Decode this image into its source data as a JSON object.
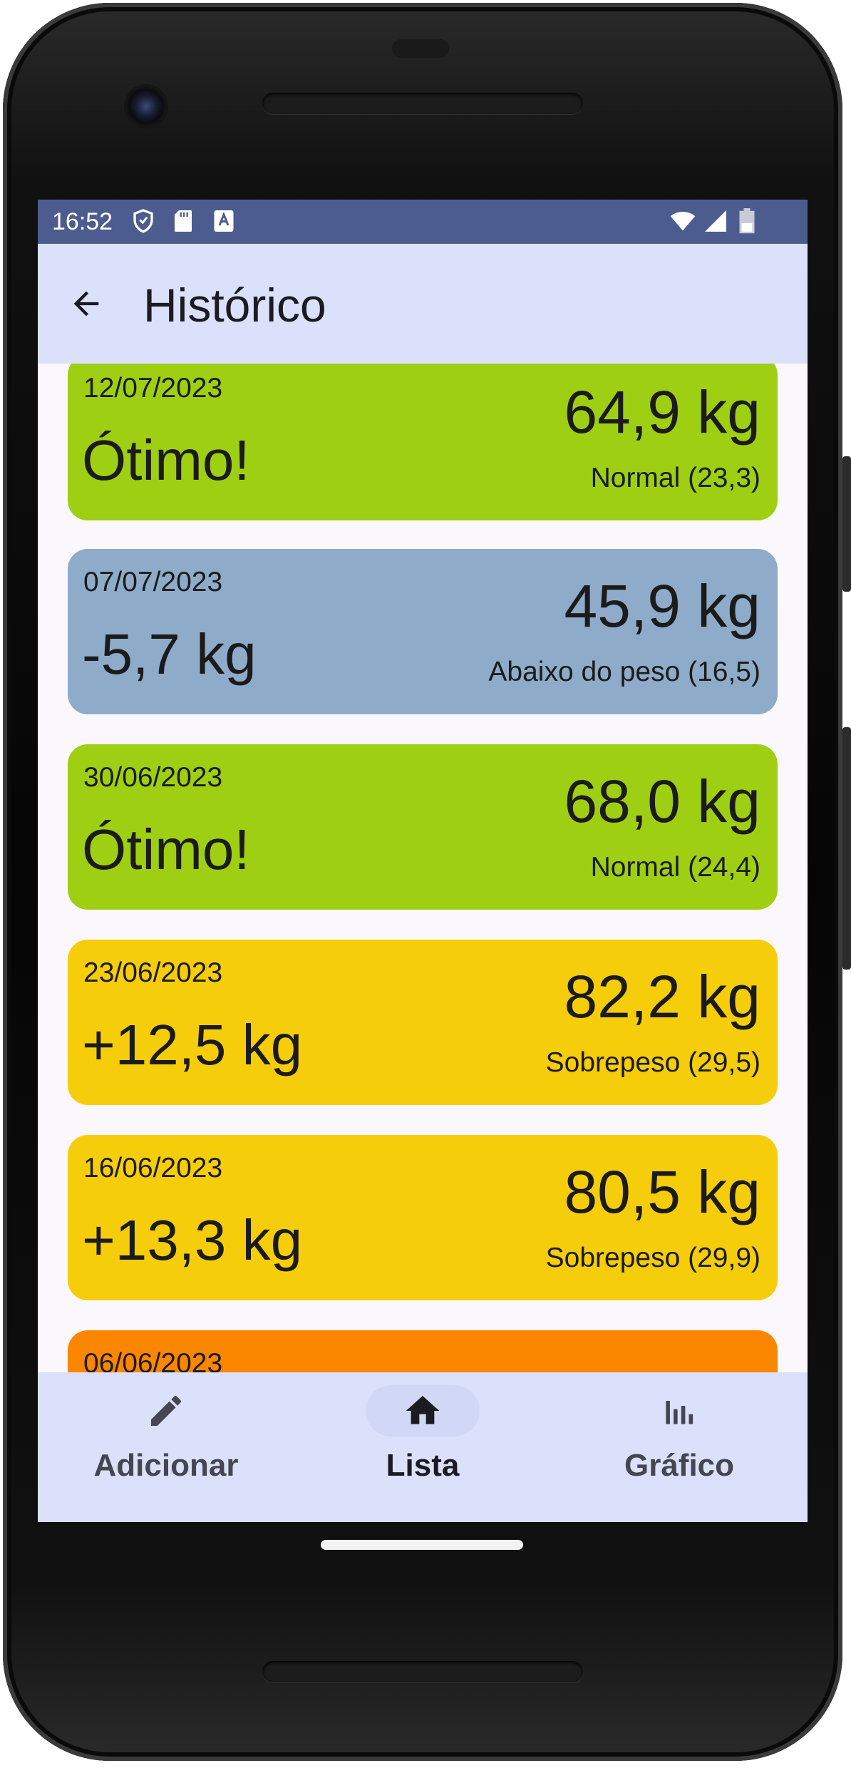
{
  "status_bar": {
    "time": "16:52",
    "left_icons": [
      "shield-icon",
      "sd-card-icon",
      "keyboard-a-icon"
    ],
    "right_icons": [
      "wifi-icon",
      "signal-icon",
      "battery-icon"
    ]
  },
  "app_bar": {
    "back_icon": "arrow-back-icon",
    "title": "Histórico"
  },
  "entries": [
    {
      "date": "12/07/2023",
      "status": "Ótimo!",
      "weight": "64,9 kg",
      "bmi": "Normal (23,3)",
      "color": "#9ecf13"
    },
    {
      "date": "07/07/2023",
      "status": "-5,7 kg",
      "weight": "45,9 kg",
      "bmi": "Abaixo do peso (16,5)",
      "color": "#8eabc9"
    },
    {
      "date": "30/06/2023",
      "status": "Ótimo!",
      "weight": "68,0 kg",
      "bmi": "Normal (24,4)",
      "color": "#9ecf13"
    },
    {
      "date": "23/06/2023",
      "status": "+12,5 kg",
      "weight": "82,2 kg",
      "bmi": "Sobrepeso (29,5)",
      "color": "#f5cd0a"
    },
    {
      "date": "16/06/2023",
      "status": "+13,3 kg",
      "weight": "80,5 kg",
      "bmi": "Sobrepeso (29,9)",
      "color": "#f5cd0a"
    },
    {
      "date": "06/06/2023",
      "status": "",
      "weight": "",
      "bmi": "",
      "color": "#fb8600"
    }
  ],
  "bottom_nav": {
    "items": [
      {
        "label": "Adicionar",
        "icon": "pencil-icon",
        "active": false
      },
      {
        "label": "Lista",
        "icon": "home-icon",
        "active": true
      },
      {
        "label": "Gráfico",
        "icon": "bar-chart-icon",
        "active": false
      }
    ]
  }
}
